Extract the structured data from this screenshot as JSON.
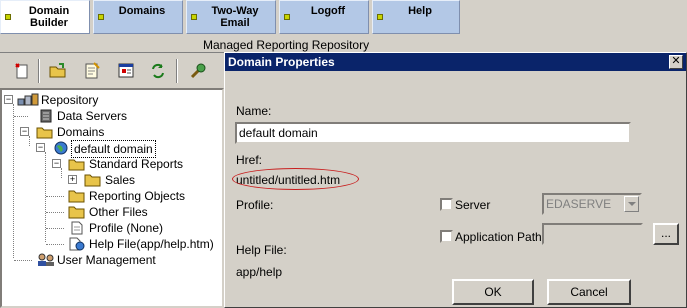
{
  "tabs": [
    {
      "label_1": "Domain",
      "label_2": "Builder",
      "active": true
    },
    {
      "label_1": "Domains",
      "label_2": "",
      "active": false
    },
    {
      "label_1": "Two-Way",
      "label_2": "Email",
      "active": false
    },
    {
      "label_1": "Logoff",
      "label_2": "",
      "active": false
    },
    {
      "label_1": "Help",
      "label_2": "",
      "active": false
    }
  ],
  "header": {
    "title": "Managed Reporting Repository"
  },
  "toolbar": {
    "icons": [
      "new-domain-icon",
      "open-folder-icon",
      "edit-document-icon",
      "properties-icon",
      "refresh-icon",
      "tools-icon"
    ]
  },
  "tree": {
    "repository": "Repository",
    "data_servers": "Data Servers",
    "domains": "Domains",
    "default_domain": "default domain",
    "standard_reports": "Standard Reports",
    "sales": "Sales",
    "reporting_objects": "Reporting Objects",
    "other_files": "Other Files",
    "profile": "Profile (None)",
    "help_file": "Help File(app/help.htm)",
    "user_management": "User Management",
    "expander_minus": "−",
    "expander_plus": "+"
  },
  "dialog": {
    "title": "Domain Properties",
    "close_glyph": "✕",
    "name_label": "Name:",
    "name_value": "default domain",
    "href_label": "Href:",
    "href_value": "untitled/untitled.htm",
    "profile_label": "Profile:",
    "server_label": "Server",
    "server_value": "EDASERVE",
    "app_path_label": "Application Path",
    "app_path_value": "",
    "browse_label": "...",
    "help_file_label": "Help File:",
    "help_file_value": "app/help",
    "ok_label": "OK",
    "cancel_label": "Cancel"
  },
  "colors": {
    "dialog_title_bg": "#0a246a",
    "tab_bg": "#b3c8e6",
    "highlight_ellipse": "#c81e1e"
  }
}
